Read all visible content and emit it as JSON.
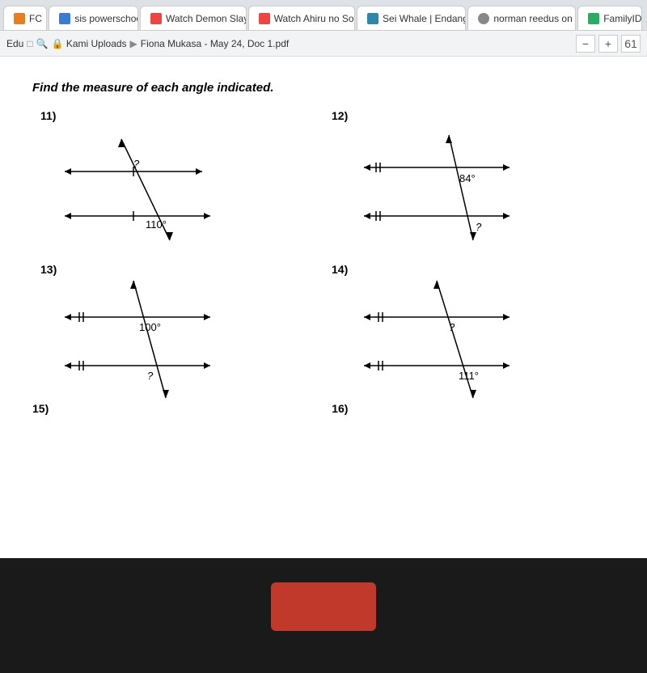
{
  "tabs": [
    {
      "label": "FC",
      "color": "orange"
    },
    {
      "label": "sis powerschool",
      "color": "blue"
    },
    {
      "label": "Watch Demon Slay...",
      "color": "red"
    },
    {
      "label": "Watch Ahiru no Sor...",
      "color": "red"
    },
    {
      "label": "Sei Whale | Endang...",
      "color": "green"
    },
    {
      "label": "norman reedus on I...",
      "color": "gray"
    },
    {
      "label": "FamilyID",
      "color": "blue"
    }
  ],
  "breadcrumb": {
    "parts": [
      "Edu",
      "Kami Uploads",
      "Fiona Mukasa - May 24, Doc 1.pdf"
    ]
  },
  "window_controls": {
    "minimize": "−",
    "maximize": "+",
    "zoom": "61"
  },
  "instruction": "Find the measure of each angle indicated.",
  "problems": [
    {
      "number": "11)",
      "known_angle": "110°",
      "unknown": "?",
      "position": "top-left"
    },
    {
      "number": "12)",
      "known_angle": "84°",
      "unknown": "?",
      "position": "top-right"
    },
    {
      "number": "13)",
      "known_angle": "100°",
      "unknown": "?",
      "position": "bottom-left"
    },
    {
      "number": "14)",
      "known_angle": "111°",
      "unknown": "?",
      "position": "bottom-right"
    }
  ],
  "partial_labels": [
    "15)",
    "16)"
  ]
}
